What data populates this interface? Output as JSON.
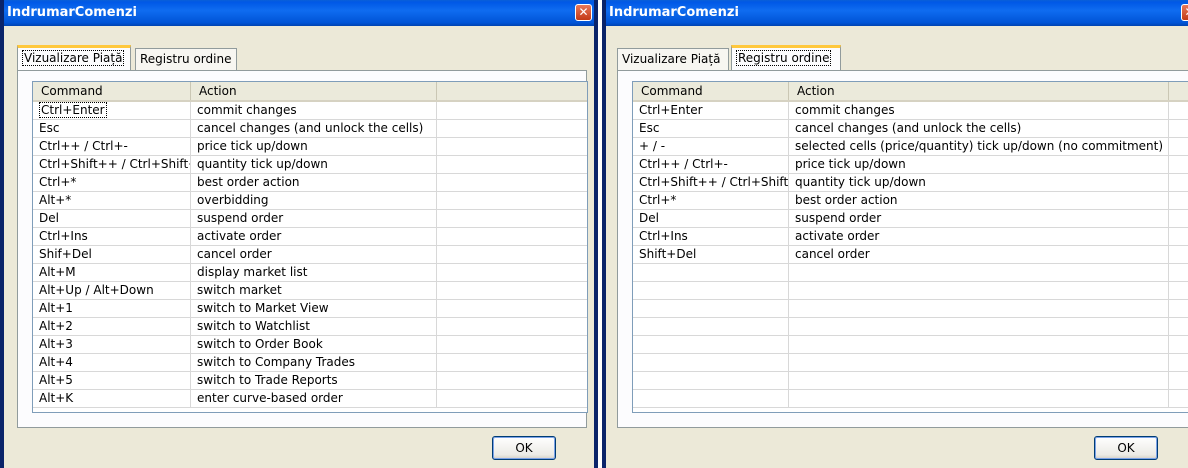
{
  "left": {
    "title": "IndrumarComenzi",
    "tabs": [
      "Vizualizare Piață",
      "Registru ordine"
    ],
    "active_tab": 0,
    "columns": [
      "Command",
      "Action"
    ],
    "rows": [
      [
        "Ctrl+Enter",
        "commit changes"
      ],
      [
        "Esc",
        "cancel changes (and unlock the cells)"
      ],
      [
        "Ctrl++ / Ctrl+-",
        "price tick up/down"
      ],
      [
        "Ctrl+Shift++ / Ctrl+Shift+-",
        "quantity tick up/down"
      ],
      [
        "Ctrl+*",
        "best order action"
      ],
      [
        "Alt+*",
        "overbidding"
      ],
      [
        "Del",
        "suspend order"
      ],
      [
        "Ctrl+Ins",
        "activate order"
      ],
      [
        "Shif+Del",
        "cancel order"
      ],
      [
        "Alt+M",
        "display market list"
      ],
      [
        "Alt+Up / Alt+Down",
        "switch market"
      ],
      [
        "Alt+1",
        "switch to Market View"
      ],
      [
        "Alt+2",
        "switch to Watchlist"
      ],
      [
        "Alt+3",
        "switch to Order Book"
      ],
      [
        "Alt+4",
        "switch to Company Trades"
      ],
      [
        "Alt+5",
        "switch to Trade Reports"
      ],
      [
        "Alt+K",
        "enter curve-based order"
      ]
    ],
    "ok_label": "OK"
  },
  "right": {
    "title": "IndrumarComenzi",
    "tabs": [
      "Vizualizare Piață",
      "Registru ordine"
    ],
    "active_tab": 1,
    "columns": [
      "Command",
      "Action"
    ],
    "rows": [
      [
        "Ctrl+Enter",
        "commit changes"
      ],
      [
        "Esc",
        "cancel changes (and unlock the cells)"
      ],
      [
        "+ / -",
        "selected cells (price/quantity) tick up/down (no commitment)"
      ],
      [
        "Ctrl++ / Ctrl+-",
        "price tick up/down"
      ],
      [
        "Ctrl+Shift++ / Ctrl+Shift+-",
        "quantity tick up/down"
      ],
      [
        "Ctrl+*",
        "best order action"
      ],
      [
        "Del",
        "suspend order"
      ],
      [
        "Ctrl+Ins",
        "activate order"
      ],
      [
        "Shift+Del",
        "cancel order"
      ]
    ],
    "ok_label": "OK"
  },
  "icons": {
    "close": "close-icon"
  },
  "colors": {
    "titlebar": "#0054e3",
    "tab_highlight": "#ffc83c",
    "window_bg": "#ece9d8"
  }
}
